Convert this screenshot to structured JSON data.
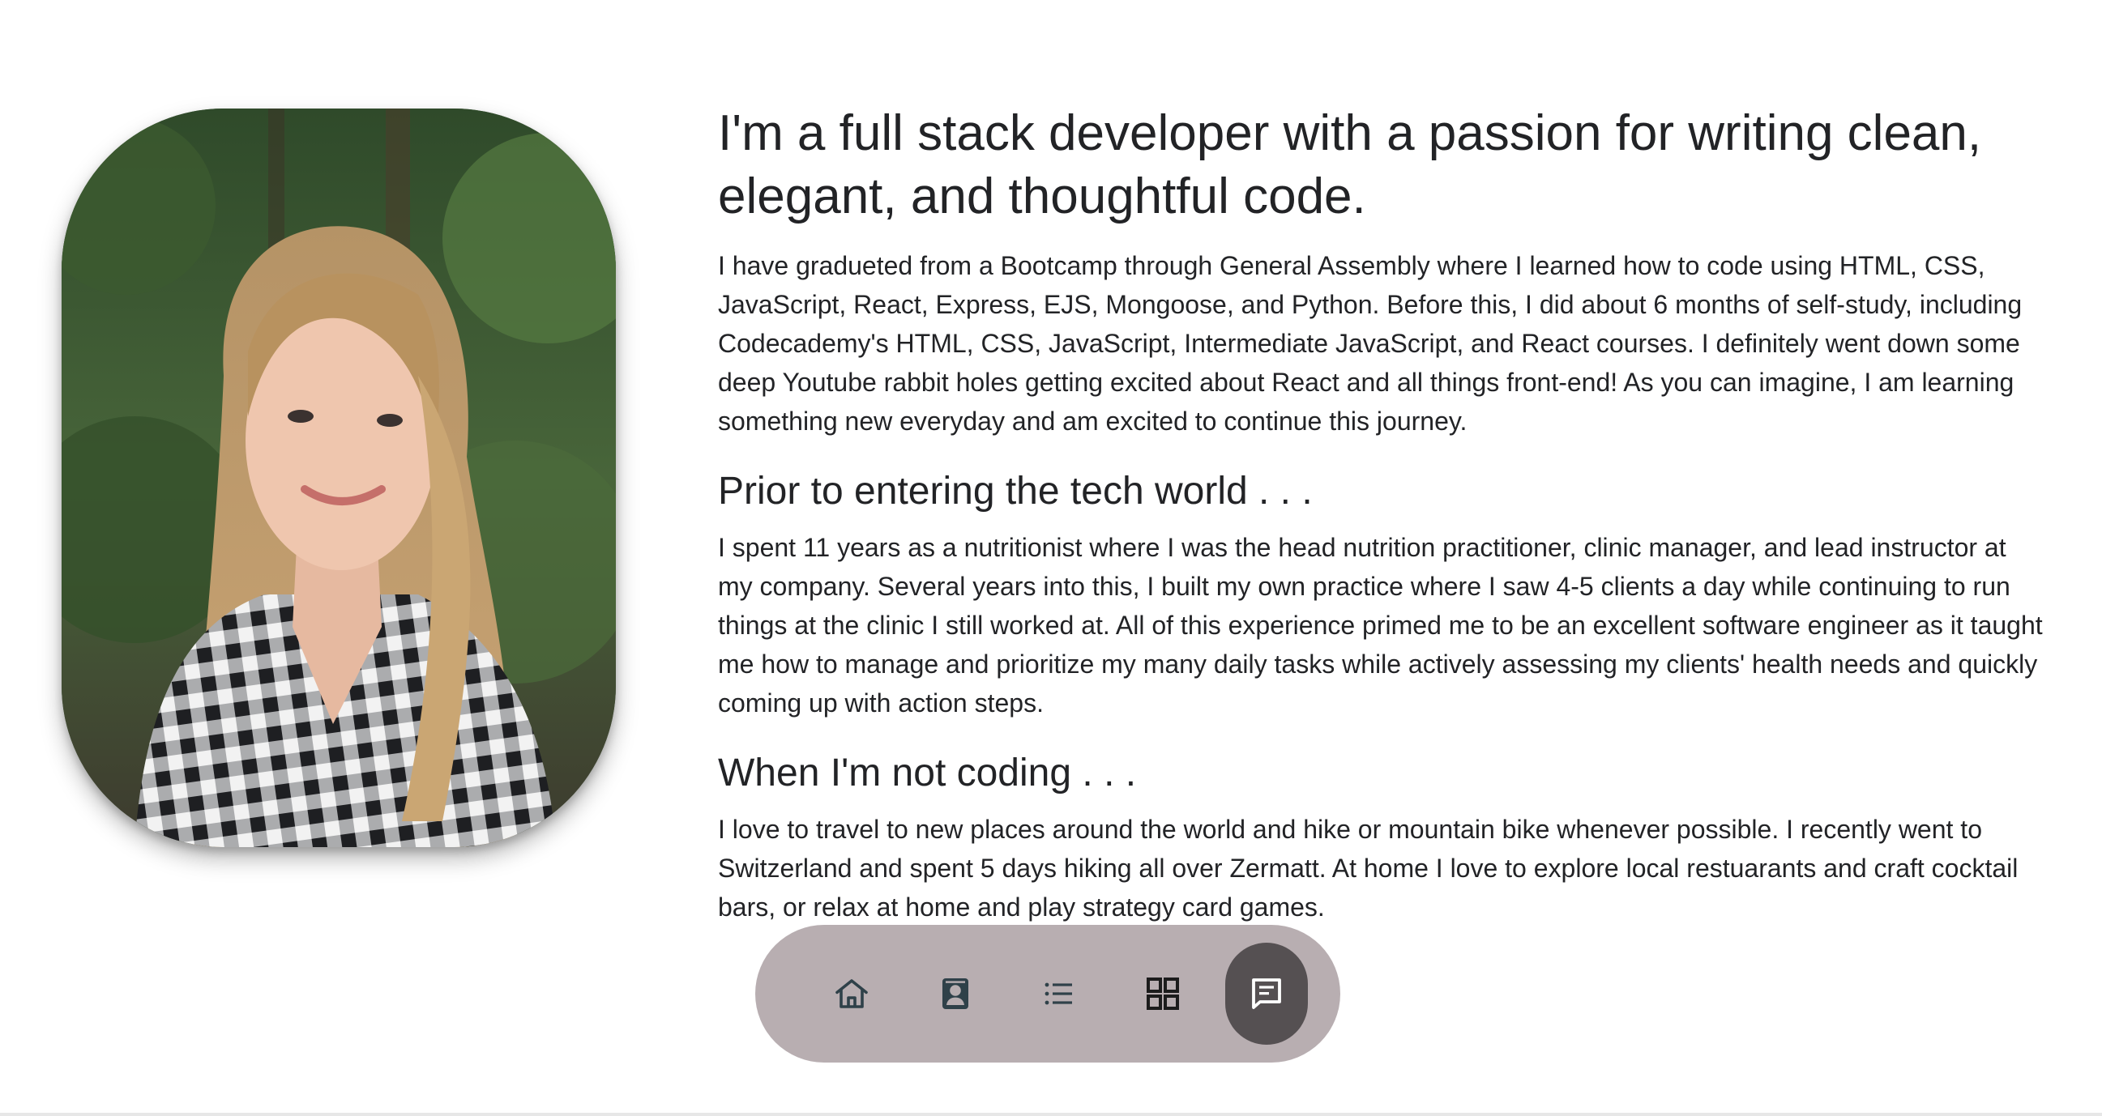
{
  "about": {
    "headline": "I'm a full stack developer with a passion for writing clean, elegant, and thoughtful code.",
    "intro": "I have gradueted from a Bootcamp through General Assembly where I learned how to code using HTML, CSS, JavaScript, React, Express, EJS, Mongoose, and Python. Before this, I did about 6 months of self-study, including Codecademy's HTML, CSS, JavaScript, Intermediate JavaScript, and React courses. I definitely went down some deep Youtube rabbit holes getting excited about React and all things front-end! As you can imagine, I am learning something new everyday and am excited to continue this journey.",
    "prior_heading": "Prior to entering the tech world . . .",
    "prior_text": "I spent 11 years as a nutritionist where I was the head nutrition practitioner, clinic manager, and lead instructor at my company. Several years into this, I built my own practice where I saw 4-5 clients a day while continuing to run things at the clinic I still worked at. All of this experience primed me to be an excellent software engineer as it taught me how to manage and prioritize my many daily tasks while actively assessing my clients' health needs and quickly coming up with action steps.",
    "hobby_heading": "When I'm not coding . . .",
    "hobby_text": "I love to travel to new places around the world and hike or mountain bike whenever possible. I recently went to Switzerland and spent 5 days hiking all over Zermatt. At home I love to explore local restuarants and craft cocktail bars, or relax at home and play strategy card games."
  },
  "nav": {
    "items": [
      {
        "icon": "home-icon",
        "active": false
      },
      {
        "icon": "contact-card-icon",
        "active": false
      },
      {
        "icon": "list-icon",
        "active": false
      },
      {
        "icon": "grid-icon",
        "active": false
      },
      {
        "icon": "message-icon",
        "active": true
      }
    ]
  },
  "colors": {
    "nav_background": "#b8aeb1",
    "nav_active": "#555052",
    "icon_dark": "#2f4149",
    "text": "#222326"
  }
}
